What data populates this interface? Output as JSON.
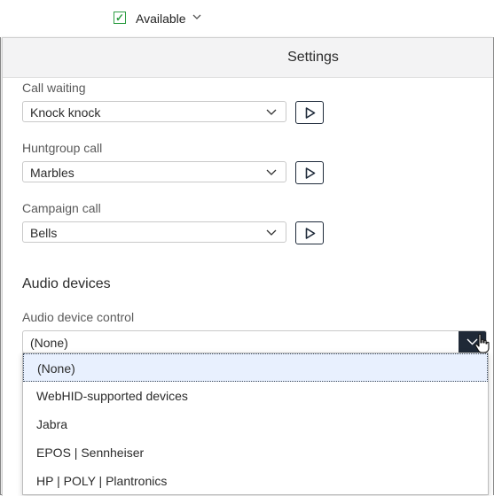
{
  "status": {
    "label": "Available",
    "check_glyph": "✓",
    "check_color": "#2e9e44"
  },
  "panel": {
    "title": "Settings"
  },
  "ringtones": [
    {
      "label": "Call waiting",
      "value": "Knock knock",
      "play": "play-icon"
    },
    {
      "label": "Huntgroup call",
      "value": "Marbles",
      "play": "play-icon"
    },
    {
      "label": "Campaign call",
      "value": "Bells",
      "play": "play-icon"
    }
  ],
  "audio": {
    "heading": "Audio devices",
    "control_label": "Audio device control",
    "control_value": "(None)",
    "options": [
      "(None)",
      "WebHID-supported devices",
      "Jabra",
      "EPOS | Sennheiser",
      "HP | POLY | Plantronics"
    ],
    "selected_index": 0
  },
  "colors": {
    "accent_dark": "#1f2937",
    "header_bg": "#f3f3f4",
    "selected_bg": "#e8f0fe"
  }
}
